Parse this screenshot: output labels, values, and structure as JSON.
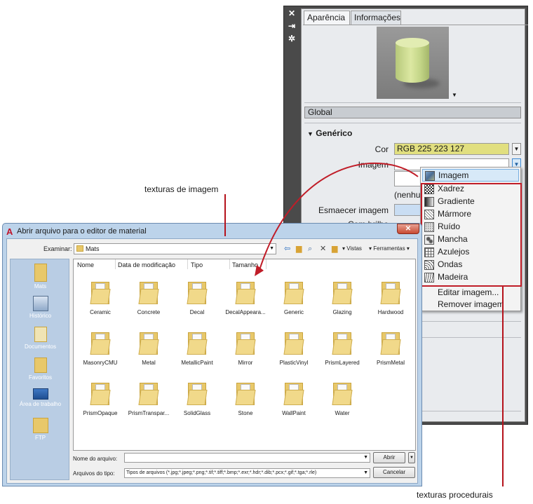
{
  "palette": {
    "tabs": [
      "Aparência",
      "Informações"
    ],
    "global_label": "Global",
    "section_title": "Genérico",
    "props": {
      "cor_label": "Cor",
      "cor_value": "RGB 225 223 127",
      "imagem_label": "Imagem",
      "nenhuma": "(nenhum",
      "esmaecer_label": "Esmaecer imagem",
      "brilho_label": "Com brilho"
    }
  },
  "popup_menu": {
    "items": [
      {
        "label": "Imagem",
        "icon": "image-icon"
      },
      {
        "label": "Xadrez",
        "icon": "checker-icon"
      },
      {
        "label": "Gradiente",
        "icon": "gradient-icon"
      },
      {
        "label": "Mármore",
        "icon": "marble-icon"
      },
      {
        "label": "Ruído",
        "icon": "noise-icon"
      },
      {
        "label": "Mancha",
        "icon": "speckle-icon"
      },
      {
        "label": "Azulejos",
        "icon": "tiles-icon"
      },
      {
        "label": "Ondas",
        "icon": "waves-icon"
      },
      {
        "label": "Madeira",
        "icon": "wood-icon"
      }
    ],
    "actions": [
      "Editar imagem...",
      "Remover imagem"
    ]
  },
  "dialog": {
    "title": "Abrir arquivo para o editor de material",
    "look_in_label": "Examinar:",
    "look_in_value": "Mats",
    "toolbar": {
      "views": "Vistas",
      "tools": "Ferramentas"
    },
    "places": [
      "Mats",
      "Histórico",
      "Documentos",
      "Favoritos",
      "Área de trabalho",
      "FTP"
    ],
    "columns": [
      "Nome",
      "Data de modificação",
      "Tipo",
      "Tamanho"
    ],
    "files": [
      "Ceramic",
      "Concrete",
      "Decal",
      "DecalAppeara...",
      "Generic",
      "Glazing",
      "Hardwood",
      "MasonryCMU",
      "Metal",
      "MetallicPaint",
      "Mirror",
      "PlasticVinyl",
      "PrismLayered",
      "PrismMetal",
      "PrismOpaque",
      "PrismTranspar...",
      "SolidGlass",
      "Stone",
      "WallPaint",
      "Water"
    ],
    "filename_label": "Nome do arquivo:",
    "filetype_label": "Arquivos do tipo:",
    "filetype_value": "Tipos de arquivos (*.jpg;*.jpeg;*.png;*.tif;*.tiff;*.bmp;*.exr;*.hdr;*.dib;*.pcx;*.gif;*.tga;*.rle)",
    "open_button": "Abrir",
    "cancel_button": "Cancelar"
  },
  "callouts": {
    "image_textures": "texturas de imagem",
    "procedural_textures": "texturas procedurais"
  },
  "colors": {
    "callout_red": "#c01d28",
    "swatch": "#e1df7f",
    "palette_frame": "#4a4a4a"
  }
}
